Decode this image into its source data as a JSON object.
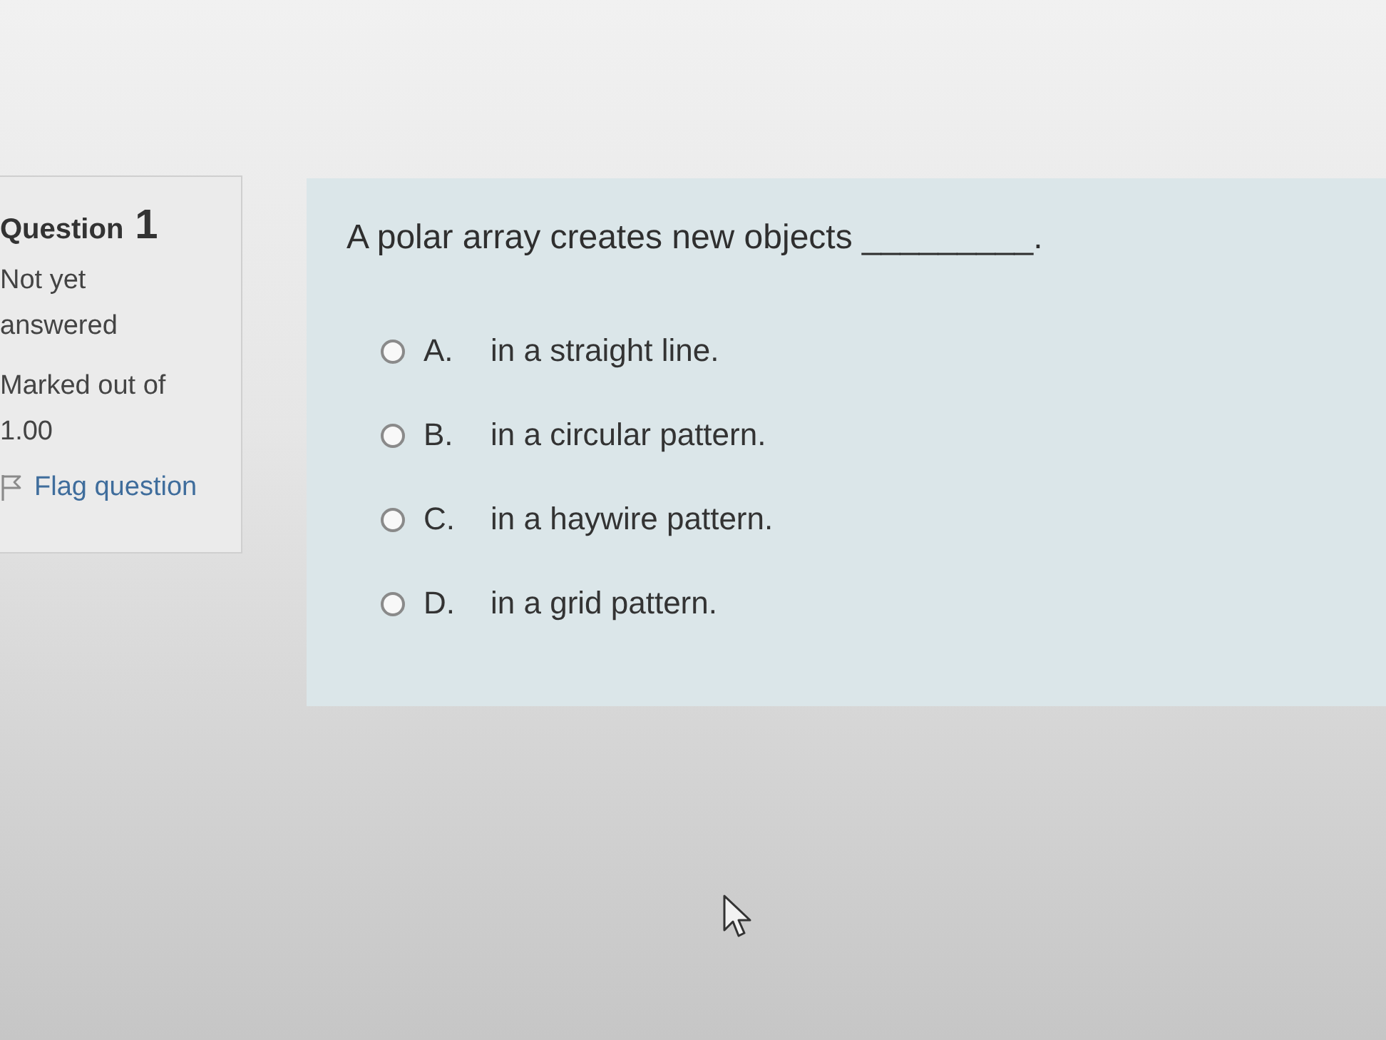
{
  "question_info": {
    "title": "Question",
    "number": "1",
    "state": "Not yet answered",
    "marks": "Marked out of 1.00",
    "flag_link": "Flag question"
  },
  "question": {
    "text": "A polar array creates new objects _________.",
    "options": [
      {
        "letter": "A.",
        "text": "in a straight line.",
        "selected": false
      },
      {
        "letter": "B.",
        "text": "in a circular pattern.",
        "selected": false
      },
      {
        "letter": "C.",
        "text": "in a haywire pattern.",
        "selected": false
      },
      {
        "letter": "D.",
        "text": "in a grid pattern.",
        "selected": false
      }
    ]
  }
}
